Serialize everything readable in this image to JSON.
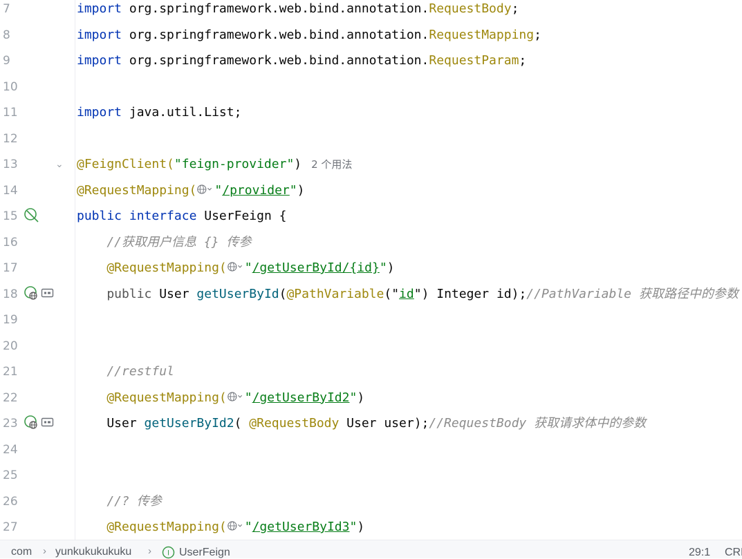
{
  "editor": {
    "lines": [
      {
        "num": "7",
        "tokens": [
          {
            "t": "import",
            "c": "kw"
          },
          {
            "t": " org.springframework.web.bind.annotation.",
            "c": "plain"
          },
          {
            "t": "RequestBody",
            "c": "imp"
          },
          {
            "t": ";",
            "c": "plain"
          }
        ]
      },
      {
        "num": "8",
        "tokens": [
          {
            "t": "import",
            "c": "kw"
          },
          {
            "t": " org.springframework.web.bind.annotation.",
            "c": "plain"
          },
          {
            "t": "RequestMapping",
            "c": "imp"
          },
          {
            "t": ";",
            "c": "plain"
          }
        ]
      },
      {
        "num": "9",
        "tokens": [
          {
            "t": "import",
            "c": "kw"
          },
          {
            "t": " org.springframework.web.bind.annotation.",
            "c": "plain"
          },
          {
            "t": "RequestParam",
            "c": "imp"
          },
          {
            "t": ";",
            "c": "plain"
          }
        ]
      },
      {
        "num": "10",
        "tokens": []
      },
      {
        "num": "11",
        "tokens": [
          {
            "t": "import",
            "c": "kw"
          },
          {
            "t": " java.util.List;",
            "c": "plain"
          }
        ]
      },
      {
        "num": "12",
        "tokens": []
      },
      {
        "num": "13",
        "fold": true,
        "tokens": [
          {
            "t": "@FeignClient(",
            "c": "ann"
          },
          {
            "t": "\"feign-provider\"",
            "c": "str"
          },
          {
            "t": ")",
            "c": "plain"
          }
        ],
        "hint": "2 个用法"
      },
      {
        "num": "14",
        "tokens": [
          {
            "t": "@RequestMapping(",
            "c": "ann"
          },
          {
            "t": "",
            "c": "globe"
          },
          {
            "t": "\"",
            "c": "str"
          },
          {
            "t": "/provider",
            "c": "str link"
          },
          {
            "t": "\"",
            "c": "str"
          },
          {
            "t": ")",
            "c": "plain"
          }
        ]
      },
      {
        "num": "15",
        "icon": "implemented",
        "tokens": [
          {
            "t": "public",
            "c": "kw"
          },
          {
            "t": " ",
            "c": "plain"
          },
          {
            "t": "interface",
            "c": "kw"
          },
          {
            "t": " UserFeign {",
            "c": "plain"
          }
        ]
      },
      {
        "num": "16",
        "tokens": [
          {
            "t": "    //获取用户信息 {} 传参",
            "c": "cm"
          }
        ]
      },
      {
        "num": "17",
        "tokens": [
          {
            "t": "    @RequestMapping(",
            "c": "ann"
          },
          {
            "t": "",
            "c": "globe"
          },
          {
            "t": "\"",
            "c": "str"
          },
          {
            "t": "/getUserById/{id}",
            "c": "str link"
          },
          {
            "t": "\"",
            "c": "str"
          },
          {
            "t": ")",
            "c": "plain"
          }
        ]
      },
      {
        "num": "18",
        "icon": "endpoint",
        "tokens": [
          {
            "t": "    public ",
            "c": "dim"
          },
          {
            "t": "User ",
            "c": "plain"
          },
          {
            "t": "getUserById",
            "c": "fn"
          },
          {
            "t": "(",
            "c": "plain"
          },
          {
            "t": "@PathVariable",
            "c": "ann"
          },
          {
            "t": "(\"",
            "c": "plain"
          },
          {
            "t": "id",
            "c": "str link"
          },
          {
            "t": "\") Integer id);",
            "c": "plain"
          },
          {
            "t": "//PathVariable 获取路径中的参数",
            "c": "cm"
          }
        ]
      },
      {
        "num": "19",
        "tokens": []
      },
      {
        "num": "20",
        "tokens": []
      },
      {
        "num": "21",
        "tokens": [
          {
            "t": "    //restful",
            "c": "cm"
          }
        ]
      },
      {
        "num": "22",
        "tokens": [
          {
            "t": "    @RequestMapping(",
            "c": "ann"
          },
          {
            "t": "",
            "c": "globe"
          },
          {
            "t": "\"",
            "c": "str"
          },
          {
            "t": "/getUserById2",
            "c": "str link"
          },
          {
            "t": "\"",
            "c": "str"
          },
          {
            "t": ")",
            "c": "plain"
          }
        ]
      },
      {
        "num": "23",
        "icon": "endpoint",
        "tokens": [
          {
            "t": "    User ",
            "c": "plain"
          },
          {
            "t": "getUserById2",
            "c": "fn"
          },
          {
            "t": "( ",
            "c": "plain"
          },
          {
            "t": "@RequestBody",
            "c": "ann"
          },
          {
            "t": " User user);",
            "c": "plain"
          },
          {
            "t": "//RequestBody 获取请求体中的参数",
            "c": "cm"
          }
        ]
      },
      {
        "num": "24",
        "tokens": []
      },
      {
        "num": "25",
        "tokens": []
      },
      {
        "num": "26",
        "tokens": [
          {
            "t": "    //? 传参",
            "c": "cm"
          }
        ]
      },
      {
        "num": "27",
        "tokens": [
          {
            "t": "    @RequestMapping(",
            "c": "ann"
          },
          {
            "t": "",
            "c": "globe"
          },
          {
            "t": "\"",
            "c": "str"
          },
          {
            "t": "/getUserById3",
            "c": "str link"
          },
          {
            "t": "\"",
            "c": "str"
          },
          {
            "t": ")",
            "c": "plain"
          }
        ]
      }
    ]
  },
  "statusbar": {
    "crumbs": [
      {
        "label": "com",
        "icon": null
      },
      {
        "label": "yunkukukukuku",
        "icon": null
      },
      {
        "label": "UserFeign",
        "icon": "interface-icon"
      }
    ],
    "position": "29:1",
    "line_ending": "CRLF"
  },
  "colors": {
    "keyword": "#0033b3",
    "annotation": "#9e880d",
    "string": "#067d17",
    "comment": "#8c8c8c",
    "method": "#00627a",
    "interface_badge": "#3c9b4a"
  }
}
